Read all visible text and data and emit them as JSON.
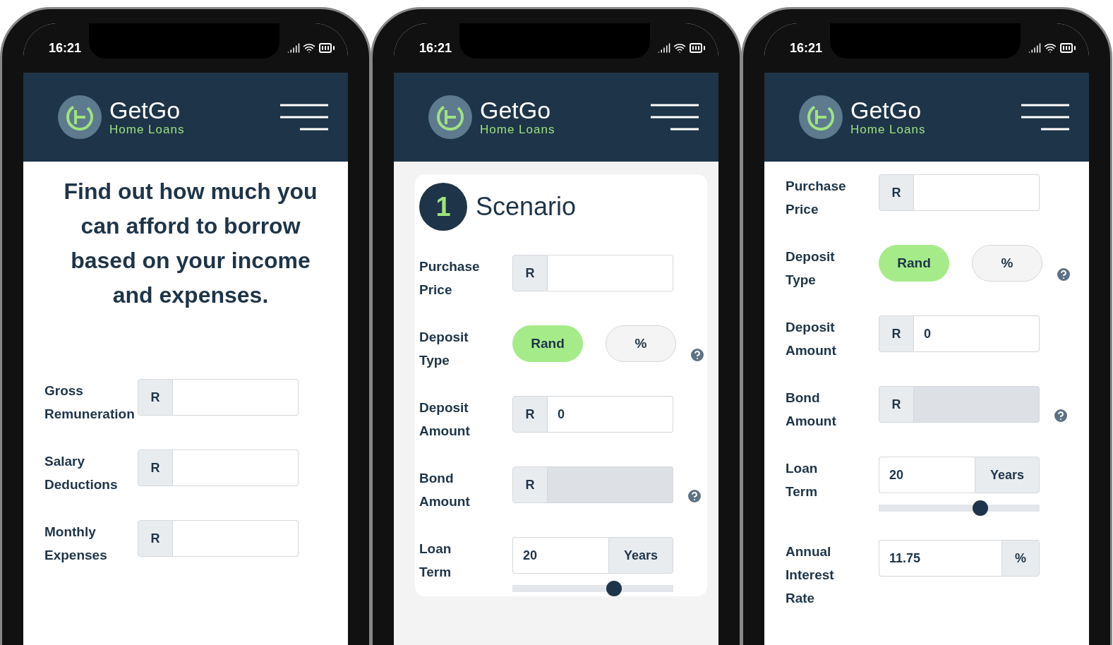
{
  "phones": [
    {
      "time": "16:21",
      "brand": {
        "name": "GetGo",
        "tagline": "Home Loans"
      },
      "heading": "Find out how much you can afford to borrow based on your income and expenses.",
      "fields": [
        {
          "kind": "money",
          "label": "Gross Remuneration",
          "prefix": "R",
          "disabled": false
        },
        {
          "kind": "money",
          "label": "Salary Deductions",
          "prefix": "R",
          "disabled": false
        },
        {
          "kind": "money",
          "label": "Monthly Expenses",
          "prefix": "R",
          "disabled": false
        }
      ]
    },
    {
      "time": "16:21",
      "brand": {
        "name": "GetGo",
        "tagline": "Home Loans"
      },
      "step": {
        "number": "1",
        "title": "Scenario"
      },
      "fields": [
        {
          "kind": "money",
          "label": "Purchase Price",
          "prefix": "R",
          "disabled": false
        },
        {
          "kind": "toggle",
          "label": "Deposit Type",
          "options": [
            {
              "label": "Rand",
              "selected": true
            },
            {
              "label": "%",
              "selected": false
            }
          ],
          "help": true
        },
        {
          "kind": "money",
          "label": "Deposit Amount",
          "prefix": "R",
          "value": "0",
          "disabled": false
        },
        {
          "kind": "money",
          "label": "Bond Amount",
          "prefix": "R",
          "disabled": true,
          "help": true
        },
        {
          "kind": "term",
          "label": "Loan Term",
          "value": "20",
          "suffix": "Years",
          "level": 0.63
        }
      ]
    },
    {
      "time": "16:21",
      "brand": {
        "name": "GetGo",
        "tagline": "Home Loans"
      },
      "fields": [
        {
          "kind": "money",
          "label": "Purchase Price",
          "prefix": "R",
          "disabled": false
        },
        {
          "kind": "toggle",
          "label": "Deposit Type",
          "options": [
            {
              "label": "Rand",
              "selected": true
            },
            {
              "label": "%",
              "selected": false
            }
          ],
          "help": true
        },
        {
          "kind": "money",
          "label": "Deposit Amount",
          "prefix": "R",
          "value": "0",
          "disabled": false
        },
        {
          "kind": "money",
          "label": "Bond Amount",
          "prefix": "R",
          "disabled": true,
          "help": true
        },
        {
          "kind": "term",
          "label": "Loan Term",
          "value": "20",
          "suffix": "Years",
          "level": 0.63
        },
        {
          "kind": "suffix",
          "label": "Annual Interest Rate",
          "value": "11.75",
          "suffix": "%"
        }
      ]
    }
  ]
}
